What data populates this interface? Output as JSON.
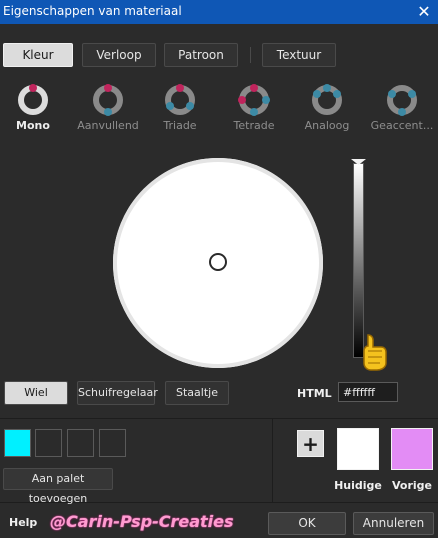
{
  "window": {
    "title": "Eigenschappen van materiaal",
    "close_glyph": "✕"
  },
  "tabs": [
    {
      "label": "Kleur",
      "active": true
    },
    {
      "label": "Verloop",
      "active": false
    },
    {
      "label": "Patroon",
      "active": false
    },
    {
      "label": "Textuur",
      "active": false
    }
  ],
  "harmonies": [
    {
      "label": "Mono",
      "selected": true,
      "icon": "mono-harmony-icon"
    },
    {
      "label": "Aanvullend",
      "selected": false,
      "icon": "complementary-harmony-icon"
    },
    {
      "label": "Triade",
      "selected": false,
      "icon": "triad-harmony-icon"
    },
    {
      "label": "Tetrade",
      "selected": false,
      "icon": "tetrad-harmony-icon"
    },
    {
      "label": "Analoog",
      "selected": false,
      "icon": "analogous-harmony-icon"
    },
    {
      "label": "Geaccent...",
      "selected": false,
      "icon": "accented-harmony-icon"
    }
  ],
  "modes": [
    {
      "label": "Wiel",
      "active": true
    },
    {
      "label": "Schuifregelaar",
      "active": false
    },
    {
      "label": "Staaltje",
      "active": false
    }
  ],
  "html": {
    "label": "HTML",
    "value": "#ffffff"
  },
  "palette": {
    "swatches": [
      "#00f0ff",
      "",
      "",
      ""
    ],
    "add_label": "Aan palet toevoegen",
    "plus_glyph": "+"
  },
  "current": {
    "label": "Huidige",
    "color": "#ffffff"
  },
  "previous": {
    "label": "Vorige",
    "color": "#e38cf5"
  },
  "footer": {
    "help_label": "Help",
    "watermark": "@Carin-Psp-Creaties",
    "ok_label": "OK",
    "cancel_label": "Annuleren"
  },
  "colors": {
    "titlebar": "#0f57b5",
    "harmony_magenta": "#c0245c",
    "harmony_blue": "#3c8aa5"
  }
}
